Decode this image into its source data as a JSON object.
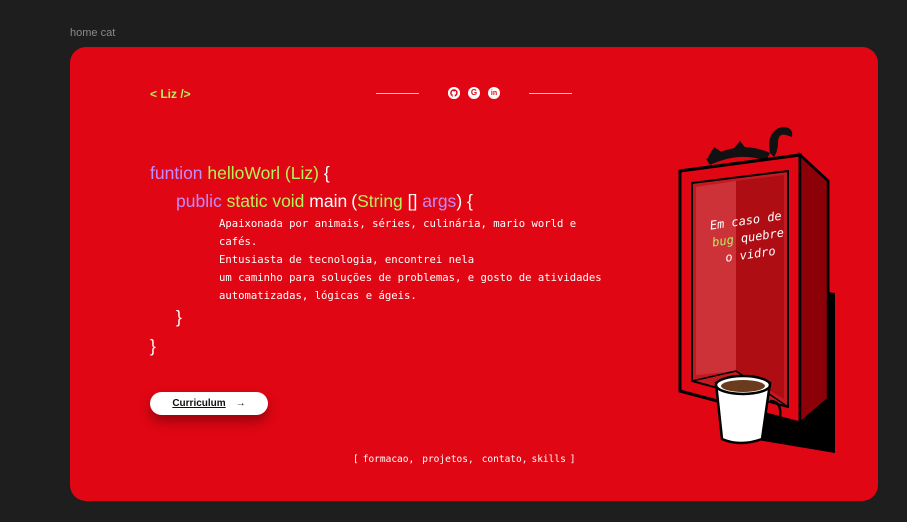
{
  "frame": {
    "label": "home cat"
  },
  "header": {
    "logo": "< Liz />",
    "social": [
      {
        "name": "github-icon",
        "glyph": "●"
      },
      {
        "name": "google-icon",
        "glyph": "G"
      },
      {
        "name": "linkedin-icon",
        "glyph": "in"
      }
    ]
  },
  "code": {
    "l1_kw": "funtion",
    "l1_name": "helloWorl",
    "l1_arg": "(Liz)",
    "l1_brace": "{",
    "l2_public": "public",
    "l2_static": "static void",
    "l2_main": "main",
    "l2_paren": "(",
    "l2_string": "String",
    "l2_brackets": "[]",
    "l2_args": "args",
    "l2_close": ") {",
    "close_inner": "}",
    "close_outer": "}"
  },
  "description": {
    "line1": "Apaixonada por animais, séries, culinária, mario world e",
    "line2": "cafés.",
    "line3": "Entusiasta de tecnologia, encontrei nela",
    "line4": "um caminho para soluções de problemas, e gosto de atividades",
    "line5": "automatizadas, lógicas e ágeis."
  },
  "cv_button": {
    "label": "Curriculum",
    "arrow": "→"
  },
  "nav": {
    "open": "[",
    "items": [
      "formacao,",
      "projetos,",
      "contato,",
      "skills"
    ],
    "close": "]"
  },
  "illustration": {
    "line1": "Em caso de",
    "bug": "bug",
    "line2_rest": " quebre",
    "line3": "o vidro"
  },
  "colors": {
    "background": "#1e1e1e",
    "card": "#e10613",
    "accent_green": "#b4f25c",
    "accent_purple": "#c38bff"
  }
}
